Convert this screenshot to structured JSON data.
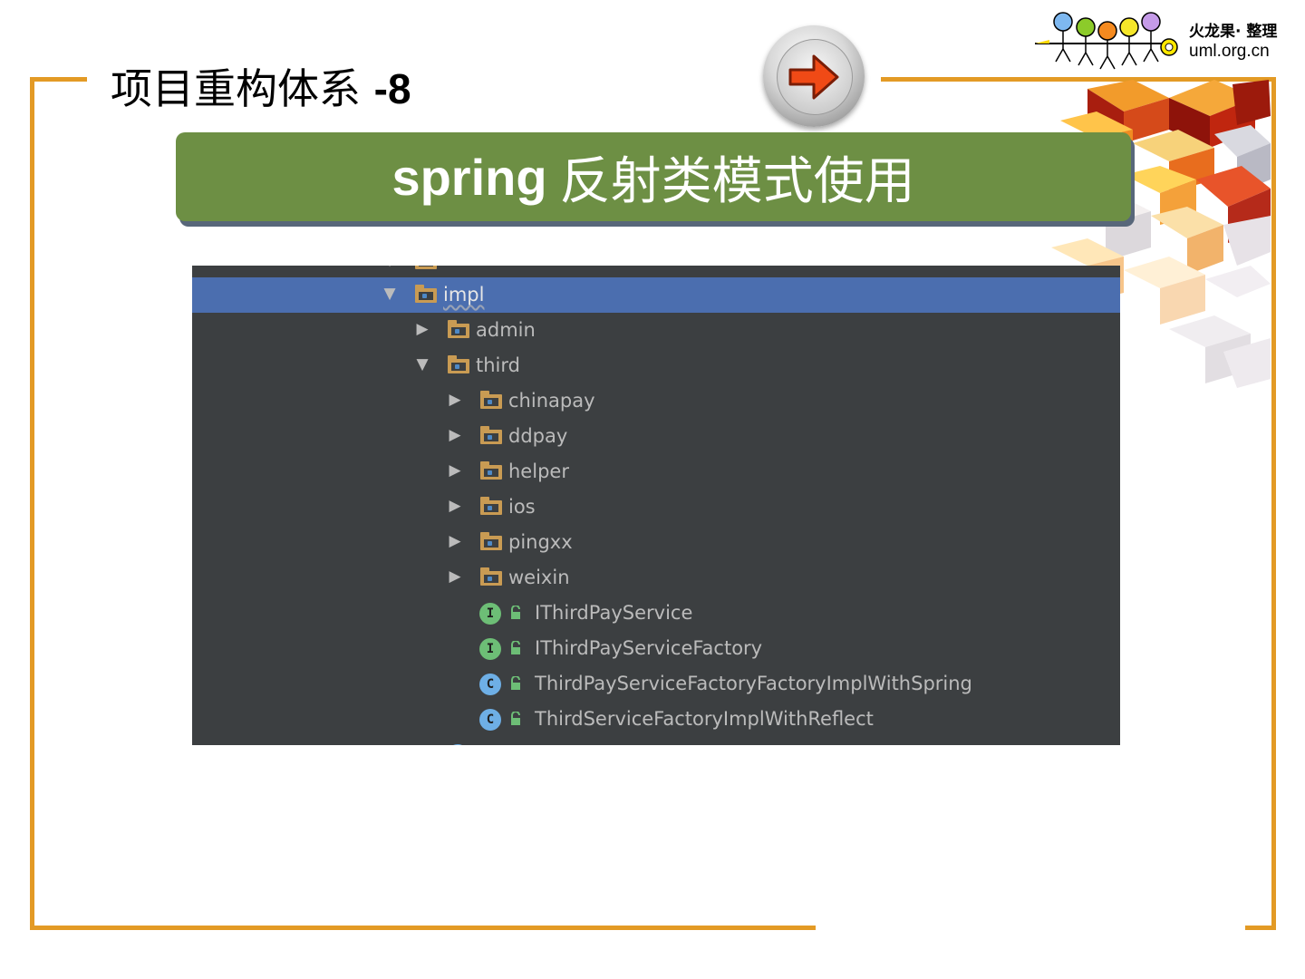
{
  "slide": {
    "title_main": "项目重构体系",
    "title_num": "-8",
    "banner_bold": "spring",
    "banner_rest": "反射类模式使用"
  },
  "logo": {
    "line1": "火龙果· 整理",
    "line2": "uml.org.cn"
  },
  "nav": {
    "next_icon": "right-arrow-icon"
  },
  "colors": {
    "frame": "#E39A25",
    "banner": "#6D8F44",
    "ide_background": "#3C3F41",
    "ide_selection": "#4B6EAF"
  },
  "tree": {
    "items": [
      {
        "label": "impl",
        "type": "folder",
        "expanded": true,
        "selected": true
      },
      {
        "label": "admin",
        "type": "folder",
        "expanded": false
      },
      {
        "label": "third",
        "type": "folder",
        "expanded": true
      },
      {
        "label": "chinapay",
        "type": "folder",
        "expanded": false
      },
      {
        "label": "ddpay",
        "type": "folder",
        "expanded": false
      },
      {
        "label": "helper",
        "type": "folder",
        "expanded": false
      },
      {
        "label": "ios",
        "type": "folder",
        "expanded": false
      },
      {
        "label": "pingxx",
        "type": "folder",
        "expanded": false
      },
      {
        "label": "weixin",
        "type": "folder",
        "expanded": false
      },
      {
        "label": "IThirdPayService",
        "type": "interface",
        "badge": "I"
      },
      {
        "label": "IThirdPayServiceFactory",
        "type": "interface",
        "badge": "I"
      },
      {
        "label": "ThirdPayServiceFactoryFactoryImplWithSpring",
        "type": "class",
        "badge": "C"
      },
      {
        "label": "ThirdServiceFactoryImplWithReflect",
        "type": "class",
        "badge": "C"
      }
    ]
  }
}
